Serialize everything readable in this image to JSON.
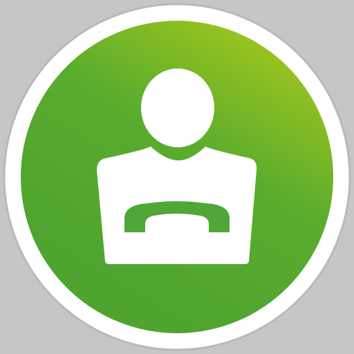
{
  "icon": {
    "name": "contact-call-icon",
    "colors": {
      "background": "#c6c6c6",
      "ring": "#ffffff",
      "ring_edge": "#b9b9b9",
      "gradient_light": "#9cc51e",
      "gradient_mid": "#5aac2d",
      "gradient_dark": "#4ea42f",
      "figure": "#ffffff",
      "handset": "#4fa738"
    }
  }
}
